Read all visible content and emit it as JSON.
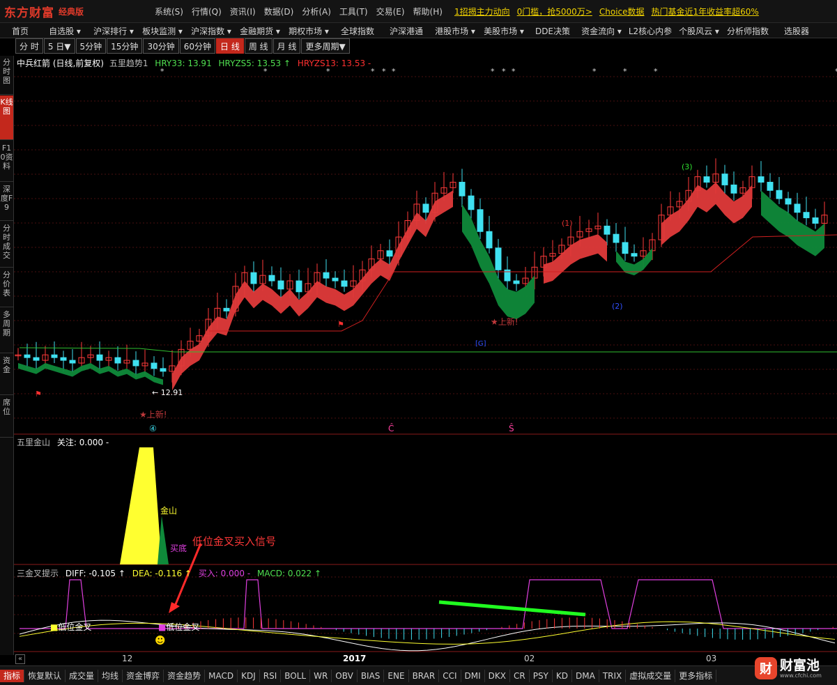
{
  "app": {
    "logo_text": "东方财富",
    "edition": "经典版"
  },
  "menu": [
    "系统(S)",
    "行情(Q)",
    "资讯(I)",
    "数据(D)",
    "分析(A)",
    "工具(T)",
    "交易(E)",
    "帮助(H)"
  ],
  "promos": [
    "1招揭主力动向",
    "0门槛，抢5000万>",
    "Choice数据",
    "热门基金近1年收益率超60%"
  ],
  "nav": [
    "首页",
    "自选股 ▾",
    "沪深排行 ▾",
    "板块监测 ▾",
    "沪深指数 ▾",
    "金融期货 ▾",
    "期权市场 ▾",
    "全球指数",
    "沪深港通",
    "港股市场 ▾",
    "美股市场 ▾",
    "DDE决策",
    "资金流向 ▾",
    "L2核心内参",
    "个股风云 ▾",
    "分析师指数",
    "选股器"
  ],
  "periods": [
    "分 时",
    "5 日▼",
    "5分钟",
    "15分钟",
    "30分钟",
    "60分钟",
    "日 线",
    "周 线",
    "月 线",
    "更多周期▼"
  ],
  "active_period": "日 线",
  "sidebar": [
    "分时图",
    "K线图",
    "F10资料",
    "深度F9",
    "分时成交",
    "分价表",
    "多周期",
    "资金",
    "席位"
  ],
  "main_chart": {
    "title": "中兵红箭 (日线,前复权)",
    "indicator": "五里趋势1",
    "hry33": "HRY33: 13.91",
    "hryzs5": "HRYZS5: 13.53 ↑",
    "hryzs13": "HRYZS13: 13.53 -",
    "price_label": "12.91",
    "new_high_labels": [
      "上新!",
      "上新!"
    ],
    "wave_labels": [
      "(1)",
      "(2)",
      "(3)"
    ],
    "circle_label": "④",
    "marks_c": "Ĉ",
    "marks_s": "Ŝ",
    "g_label": "[G]"
  },
  "panel2": {
    "name": "五里金山",
    "value_text": "关注: 0.000 -",
    "label_jin": "金山",
    "label_di": "买底"
  },
  "annotation": "低位金叉买入信号",
  "panel3": {
    "name": "三金叉提示",
    "diff": "DIFF: -0.105 ↑",
    "dea": "DEA: -0.116 ↑",
    "buy": "买入: 0.000 -",
    "macd": "MACD: 0.022 ↑",
    "low_cross_1": "低位金叉",
    "low_cross_2": "低位金叉"
  },
  "xaxis": [
    "12",
    "2017",
    "02",
    "03"
  ],
  "bottom_tabs": [
    "指标",
    "恢复默认",
    "成交量",
    "均线",
    "资金博弈",
    "资金趋势",
    "MACD",
    "KDJ",
    "RSI",
    "BOLL",
    "WR",
    "OBV",
    "BIAS",
    "ENE",
    "BRAR",
    "CCI",
    "DMI",
    "DKX",
    "CR",
    "PSY",
    "KD",
    "DMA",
    "TRIX",
    "虚拟成交量",
    "更多指标"
  ],
  "watermark": {
    "brand": "财富池",
    "url": "www.cfchi.com"
  },
  "colors": {
    "up": "#ff3a3a",
    "down": "#3fe0f0",
    "band_red": "#e03a3a",
    "band_green": "#0f8a3a",
    "accent": "#c3281c"
  }
}
